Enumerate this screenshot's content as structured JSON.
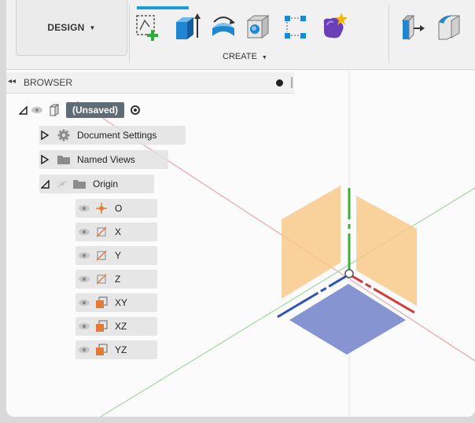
{
  "toolbar": {
    "workspace_label": "DESIGN",
    "workspace_caret": "▼",
    "create_label": "CREATE",
    "create_caret": "▼",
    "tools": [
      {
        "name": "create-sketch-icon"
      },
      {
        "name": "extrude-icon"
      },
      {
        "name": "revolve-icon"
      },
      {
        "name": "hole-icon"
      },
      {
        "name": "pattern-icon"
      },
      {
        "name": "create-form-icon"
      },
      {
        "name": "press-pull-icon"
      },
      {
        "name": "fillet-icon"
      }
    ]
  },
  "browser": {
    "title": "BROWSER",
    "collapse_icon": "◂◂",
    "root": {
      "label": "(Unsaved)"
    },
    "items": [
      {
        "label": "Document Settings"
      },
      {
        "label": "Named Views"
      },
      {
        "label": "Origin"
      }
    ],
    "origin_children": [
      {
        "label": "O"
      },
      {
        "label": "X"
      },
      {
        "label": "Y"
      },
      {
        "label": "Z"
      },
      {
        "label": "XY"
      },
      {
        "label": "XZ"
      },
      {
        "label": "YZ"
      }
    ]
  },
  "colors": {
    "accent": "#1b9bd7",
    "plane_orange": "#f7c98a",
    "plane_blue": "#7f8fcf",
    "axis_red": "#d23c3c",
    "axis_green": "#3fae3f",
    "axis_blue": "#2f52b8",
    "unsaved_badge": "#5f6b75"
  }
}
